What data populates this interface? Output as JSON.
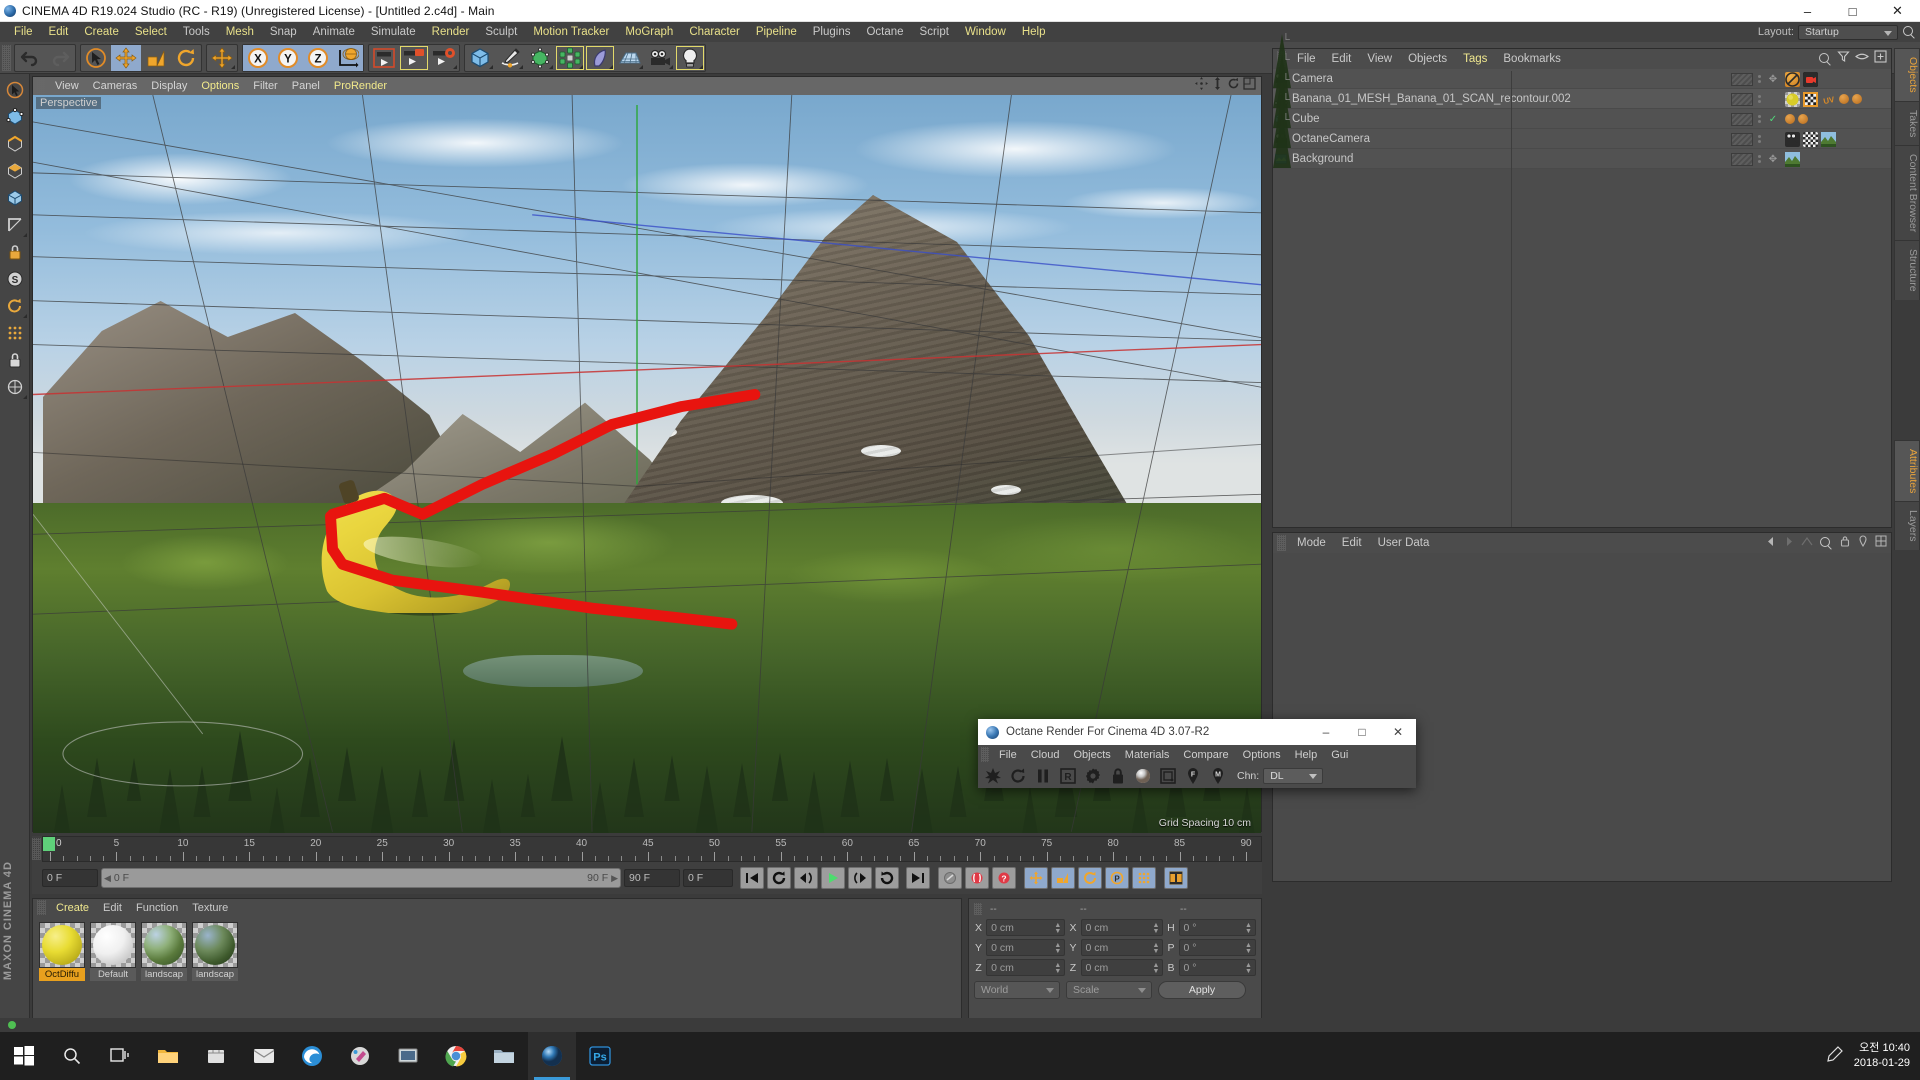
{
  "window": {
    "title": "CINEMA 4D R19.024 Studio (RC - R19) (Unregistered License) - [Untitled 2.c4d] - Main",
    "minimize": "–",
    "maximize": "□",
    "close": "✕"
  },
  "menubar": {
    "items": [
      "File",
      "Edit",
      "Create",
      "Select",
      "Tools",
      "Mesh",
      "Snap",
      "Animate",
      "Simulate",
      "Render",
      "Sculpt",
      "Motion Tracker",
      "MoGraph",
      "Character",
      "Pipeline",
      "Plugins",
      "Octane",
      "Script",
      "Window",
      "Help"
    ],
    "highlighted": [
      "File",
      "Edit",
      "Create",
      "Select",
      "Mesh",
      "Render",
      "Motion Tracker",
      "MoGraph",
      "Character",
      "Pipeline",
      "Window",
      "Help"
    ],
    "layout_label": "Layout:",
    "layout_value": "Startup"
  },
  "toolbar": {
    "icons": [
      "undo-icon",
      "redo-icon",
      "select-live-icon",
      "move-icon",
      "scale-icon",
      "rotate-icon",
      "axis-move-icon",
      "x-axis-icon",
      "y-axis-icon",
      "z-axis-icon",
      "world-coord-icon",
      "render-view-icon",
      "render-picture-icon",
      "render-settings-icon",
      "cube-icon",
      "pen-icon",
      "subdivide-icon",
      "mograph-icon",
      "deformer-icon",
      "floor-icon",
      "camera-icon",
      "light-icon"
    ],
    "axis_labels": [
      "X",
      "Y",
      "Z"
    ]
  },
  "left_rail": {
    "icons": [
      "live-selection-icon",
      "point-mode-icon",
      "edge-mode-icon",
      "polygon-mode-icon",
      "model-mode-icon",
      "texture-mode-icon",
      "axis-mode-icon",
      "enable-axis-icon",
      "object-mode-icon",
      "scale-snap-icon",
      "lock-icon",
      "workplane-icon"
    ],
    "brand": "MAXON CINEMA 4D"
  },
  "viewport": {
    "menu": [
      "View",
      "Cameras",
      "Display",
      "Options",
      "Filter",
      "Panel",
      "ProRender"
    ],
    "menu_highlighted": [
      "Options",
      "ProRender"
    ],
    "label": "Perspective",
    "grid_note": "Grid Spacing 10 cm",
    "icons": [
      "pan-icon",
      "dolly-icon",
      "rotate-view-icon",
      "maximize-view-icon"
    ]
  },
  "timeline": {
    "ticks": [
      0,
      5,
      10,
      15,
      20,
      25,
      30,
      35,
      40,
      45,
      50,
      55,
      60,
      65,
      70,
      75,
      80,
      85,
      90
    ],
    "playhead_frame": "0",
    "current_frame_field": "0 F",
    "range_start": "0 F",
    "range_end": "90 F",
    "max_frame_field": "90 F",
    "end_frame_field": "0 F",
    "transport": [
      "go-to-start-icon",
      "play-backward-icon",
      "step-back-icon",
      "play-icon",
      "step-forward-icon",
      "play-forward-icon",
      "go-to-end-icon"
    ],
    "record": [
      "record-active-objects-icon",
      "autokeying-icon",
      "keyframe-selection-icon"
    ],
    "keyframe_toggles": [
      "position-key-icon",
      "scale-key-icon",
      "rotation-key-icon",
      "param-key-icon",
      "point-level-key-icon"
    ],
    "timeline_icon": "timeline-icon"
  },
  "materials": {
    "menu": [
      "Create",
      "Edit",
      "Function",
      "Texture"
    ],
    "menu_highlighted": [
      "Create"
    ],
    "items": [
      {
        "name": "OctDiffu",
        "type": "yellow-sphere",
        "selected": true
      },
      {
        "name": "Default",
        "type": "white-sphere",
        "selected": false
      },
      {
        "name": "landscap",
        "type": "texture-sphere",
        "selected": false
      },
      {
        "name": "landscap",
        "type": "texture-sphere-dark",
        "selected": false
      }
    ]
  },
  "coordinates": {
    "header": [
      "--",
      "--",
      "--"
    ],
    "rows": [
      {
        "pos_label": "X",
        "pos_value": "0 cm",
        "size_label": "X",
        "size_value": "0 cm",
        "rot_label": "H",
        "rot_value": "0 °"
      },
      {
        "pos_label": "Y",
        "pos_value": "0 cm",
        "size_label": "Y",
        "size_value": "0 cm",
        "rot_label": "P",
        "rot_value": "0 °"
      },
      {
        "pos_label": "Z",
        "pos_value": "0 cm",
        "size_label": "Z",
        "size_value": "0 cm",
        "rot_label": "B",
        "rot_value": "0 °"
      }
    ],
    "system": "World",
    "mode": "Scale",
    "apply": "Apply"
  },
  "object_manager": {
    "menu": [
      "File",
      "Edit",
      "View",
      "Objects",
      "Tags",
      "Bookmarks"
    ],
    "menu_highlighted": [
      "Tags"
    ],
    "header_icons": [
      "search-icon",
      "filter-icon",
      "eye-icon",
      "add-layer-icon"
    ],
    "objects": [
      {
        "name": "Camera",
        "icon": "camera-object-icon",
        "tags": [
          "no-render-tag",
          "red-camera-tag"
        ]
      },
      {
        "name": "Banana_01_MESH_Banana_01_SCAN_recontour.002",
        "icon": "polygon-object-icon",
        "tags": [
          "yellow-material-tag",
          "checker-texture-tag",
          "uv-tag",
          "octane-tag-1",
          "octane-tag-2"
        ]
      },
      {
        "name": "Cube",
        "icon": "cube-object-icon",
        "tags": [
          "octane-tag-1",
          "octane-tag-2"
        ]
      },
      {
        "name": "OctaneCamera",
        "icon": "camera-object-icon",
        "tags": [
          "octane-camera-tag",
          "checker-tag",
          "landscape-texture-tag"
        ]
      },
      {
        "name": "Background",
        "icon": "background-object-icon",
        "tags": [
          "landscape-texture-tag"
        ]
      }
    ]
  },
  "attribute_manager": {
    "menu": [
      "Mode",
      "Edit",
      "User Data"
    ],
    "right_icons": [
      "back-arrow-icon",
      "forward-arrow-icon",
      "search-icon",
      "lock-icon",
      "pin-icon",
      "grid-icon"
    ]
  },
  "side_tabs": {
    "top": [
      {
        "label": "Objects",
        "active": true
      },
      {
        "label": "Takes",
        "active": false
      },
      {
        "label": "Content Browser",
        "active": false
      },
      {
        "label": "Structure",
        "active": false
      }
    ],
    "bottom": [
      {
        "label": "Attributes",
        "active": true
      },
      {
        "label": "Layers",
        "active": false
      }
    ]
  },
  "octane_dialog": {
    "title": "Octane Render For Cinema 4D 3.07-R2",
    "minimize": "–",
    "maximize": "□",
    "close": "✕",
    "menu": [
      "File",
      "Cloud",
      "Objects",
      "Materials",
      "Compare",
      "Options",
      "Help",
      "Gui"
    ],
    "tools": [
      "restart-render-icon",
      "refresh-icon",
      "pause-icon",
      "region-render-icon",
      "settings-gear-icon",
      "lock-icon",
      "material-preview-icon",
      "picture-viewer-icon",
      "focus-picker-icon",
      "material-picker-icon"
    ],
    "channel_label": "Chn:",
    "channel_value": "DL"
  },
  "taskbar": {
    "items": [
      "start-icon",
      "search-icon",
      "task-view-icon",
      "file-explorer-icon",
      "store-icon",
      "mail-icon",
      "edge-icon",
      "paint-icon",
      "vbox-icon",
      "chrome-icon",
      "folder-icon",
      "c4d-icon",
      "photoshop-icon"
    ],
    "tray_icons": [
      "pen-tray-icon"
    ],
    "time": "오전 10:40",
    "date": "2018-01-29"
  },
  "colors": {
    "accent_orange": "#e8a33c",
    "menu_highlight": "#f0e88f",
    "selection_blue": "#8fa9cc",
    "annotation_red": "#e8140f",
    "playhead_green": "#5fd07a"
  }
}
